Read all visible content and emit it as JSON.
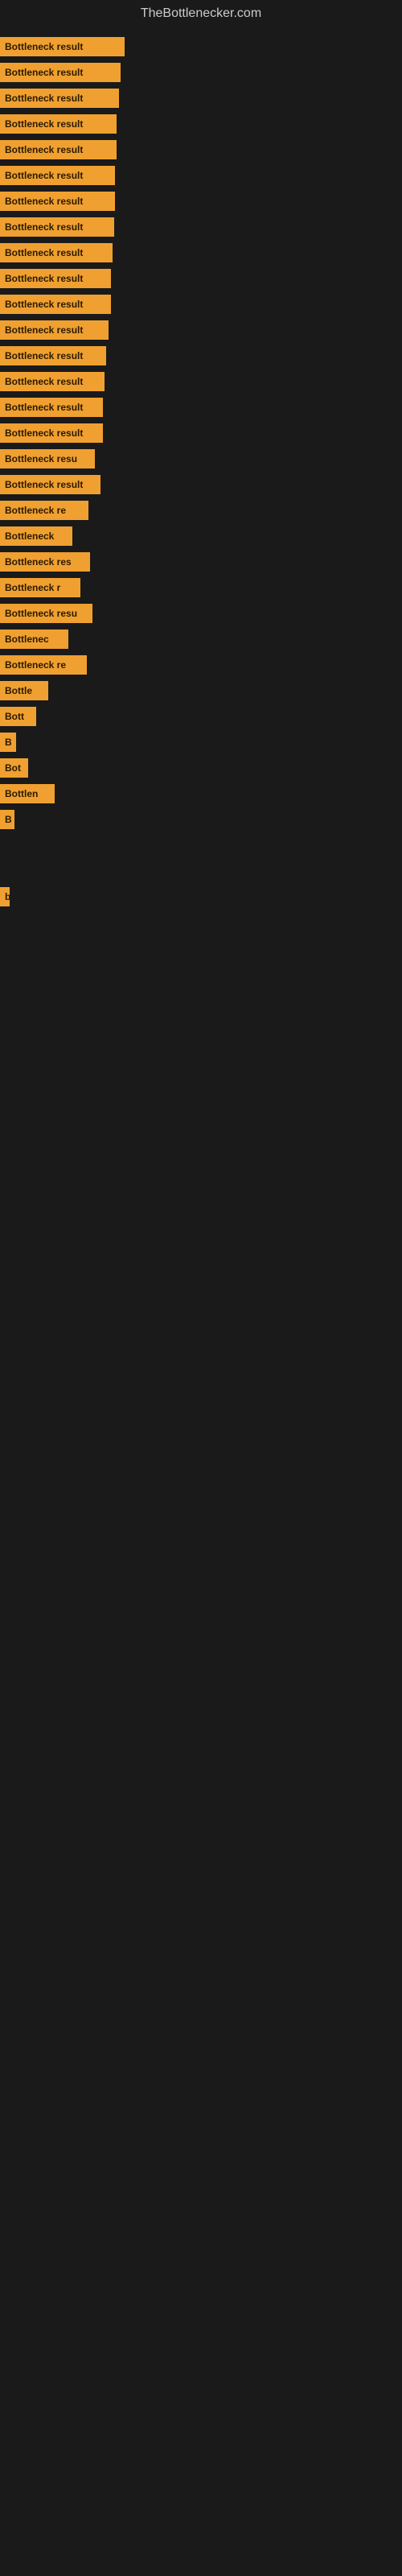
{
  "site": {
    "title": "TheBottlenecker.com"
  },
  "bars": [
    {
      "label": "Bottleneck result",
      "width": 155
    },
    {
      "label": "Bottleneck result",
      "width": 150
    },
    {
      "label": "Bottleneck result",
      "width": 148
    },
    {
      "label": "Bottleneck result",
      "width": 145
    },
    {
      "label": "Bottleneck result",
      "width": 145
    },
    {
      "label": "Bottleneck result",
      "width": 143
    },
    {
      "label": "Bottleneck result",
      "width": 143
    },
    {
      "label": "Bottleneck result",
      "width": 142
    },
    {
      "label": "Bottleneck result",
      "width": 140
    },
    {
      "label": "Bottleneck result",
      "width": 138
    },
    {
      "label": "Bottleneck result",
      "width": 138
    },
    {
      "label": "Bottleneck result",
      "width": 135
    },
    {
      "label": "Bottleneck result",
      "width": 132
    },
    {
      "label": "Bottleneck result",
      "width": 130
    },
    {
      "label": "Bottleneck result",
      "width": 128
    },
    {
      "label": "Bottleneck result",
      "width": 128
    },
    {
      "label": "Bottleneck resu",
      "width": 118
    },
    {
      "label": "Bottleneck result",
      "width": 125
    },
    {
      "label": "Bottleneck re",
      "width": 110
    },
    {
      "label": "Bottleneck",
      "width": 90
    },
    {
      "label": "Bottleneck res",
      "width": 112
    },
    {
      "label": "Bottleneck r",
      "width": 100
    },
    {
      "label": "Bottleneck resu",
      "width": 115
    },
    {
      "label": "Bottlenec",
      "width": 85
    },
    {
      "label": "Bottleneck re",
      "width": 108
    },
    {
      "label": "Bottle",
      "width": 60
    },
    {
      "label": "Bott",
      "width": 45
    },
    {
      "label": "B",
      "width": 20
    },
    {
      "label": "Bot",
      "width": 35
    },
    {
      "label": "Bottlen",
      "width": 68
    },
    {
      "label": "B",
      "width": 18
    },
    {
      "label": "",
      "width": 0
    },
    {
      "label": "",
      "width": 0
    },
    {
      "label": "b",
      "width": 12
    },
    {
      "label": "",
      "width": 0
    },
    {
      "label": "",
      "width": 0
    },
    {
      "label": "",
      "width": 0
    },
    {
      "label": "",
      "width": 0
    }
  ]
}
